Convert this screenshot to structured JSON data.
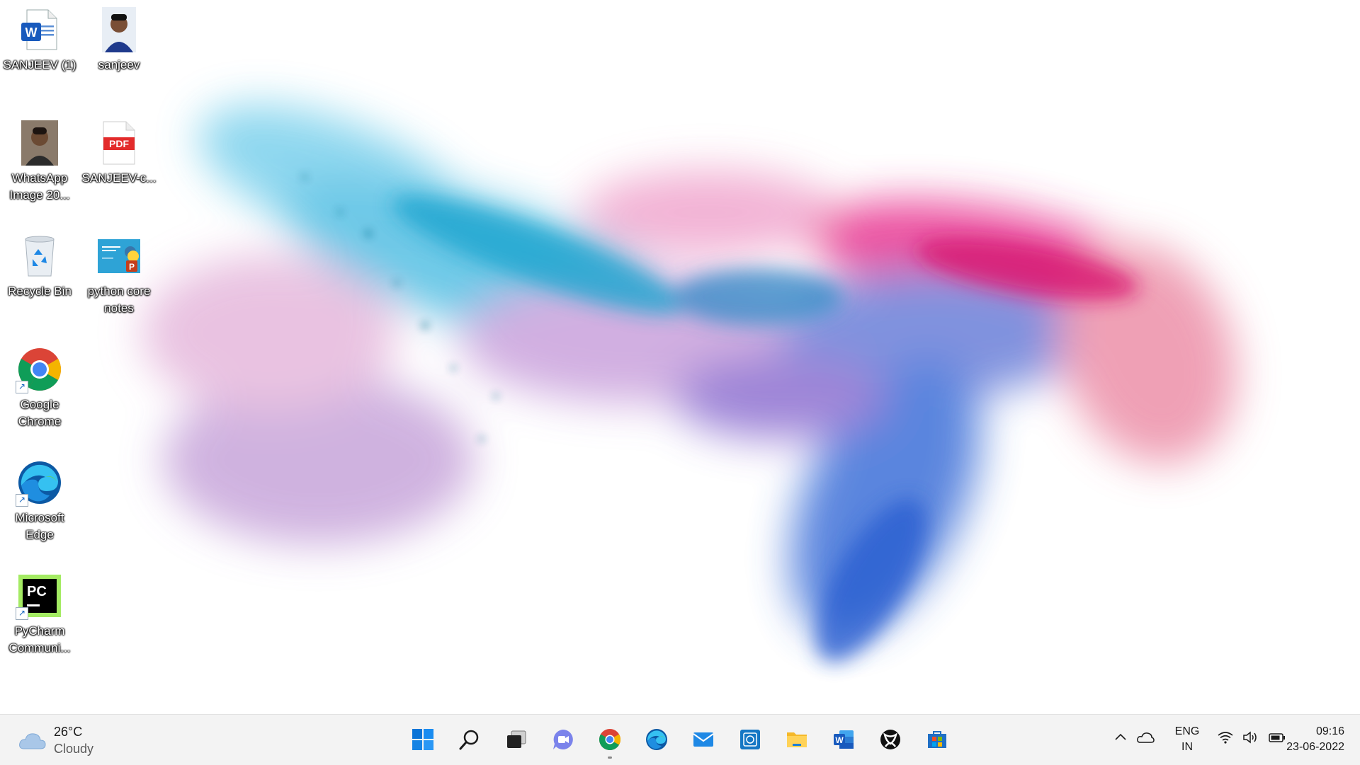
{
  "desktop": {
    "icons": [
      {
        "label": "SANJEEV (1)",
        "type": "word-doc"
      },
      {
        "label": "sanjeev",
        "type": "photo"
      },
      {
        "label": "WhatsApp Image 20...",
        "type": "photo"
      },
      {
        "label": "SANJEEV-c...",
        "type": "pdf"
      },
      {
        "label": "Recycle Bin",
        "type": "recycle-bin"
      },
      {
        "label": "python core notes",
        "type": "powerpoint"
      },
      {
        "label": "Google Chrome",
        "type": "chrome-shortcut"
      },
      {
        "label": "Microsoft Edge",
        "type": "edge-shortcut"
      },
      {
        "label": "PyCharm Communi...",
        "type": "pycharm-shortcut"
      }
    ],
    "pdf_badge": "PDF",
    "pycharm_badge": "PC"
  },
  "taskbar": {
    "weather": {
      "temperature": "26°C",
      "condition": "Cloudy",
      "icon": "cloud-icon"
    },
    "apps": [
      {
        "name": "start",
        "icon": "windows-logo-icon"
      },
      {
        "name": "search",
        "icon": "search-icon"
      },
      {
        "name": "task-view",
        "icon": "task-view-icon"
      },
      {
        "name": "chat",
        "icon": "teams-chat-icon"
      },
      {
        "name": "chrome",
        "icon": "chrome-icon",
        "running": true
      },
      {
        "name": "edge",
        "icon": "edge-icon"
      },
      {
        "name": "mail",
        "icon": "mail-icon"
      },
      {
        "name": "photo-viewer",
        "icon": "photo-viewer-icon"
      },
      {
        "name": "file-explorer",
        "icon": "folder-icon"
      },
      {
        "name": "word",
        "icon": "word-icon"
      },
      {
        "name": "xbox",
        "icon": "xbox-icon"
      },
      {
        "name": "store",
        "icon": "store-icon"
      }
    ],
    "tray": {
      "language_line1": "ENG",
      "language_line2": "IN",
      "time": "09:16",
      "date": "23-06-2022"
    }
  },
  "colors": {
    "taskbar_bg": "#f3f3f3",
    "accent_blue": "#0078d4",
    "word_blue": "#185abd"
  }
}
